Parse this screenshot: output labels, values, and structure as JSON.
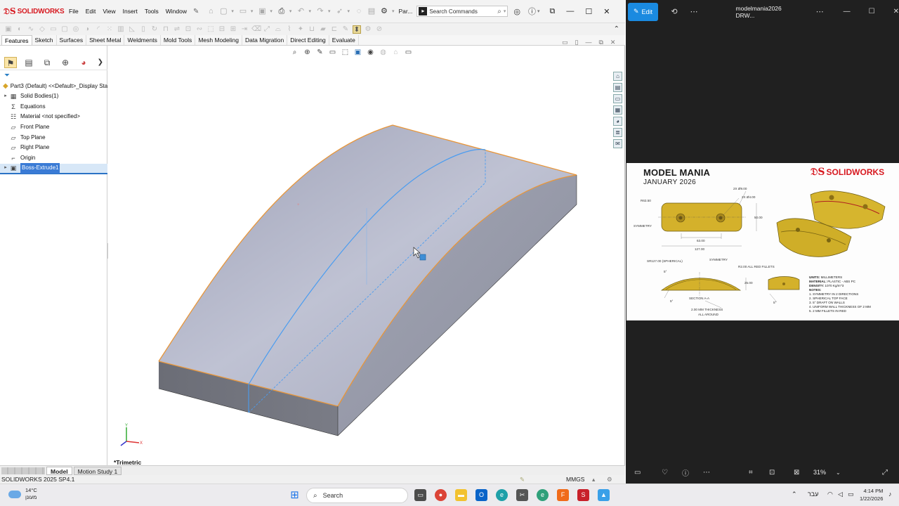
{
  "solidworks": {
    "brand": "SOLIDWORKS",
    "menus": [
      "File",
      "Edit",
      "View",
      "Insert",
      "Tools",
      "Window"
    ],
    "doc_label": "Par...",
    "search_placeholder": "Search Commands",
    "command_tabs": [
      "Features",
      "Sketch",
      "Surfaces",
      "Sheet Metal",
      "Weldments",
      "Mold Tools",
      "Mesh Modeling",
      "Data Migration",
      "Direct Editing",
      "Evaluate"
    ],
    "active_tab": "Features",
    "tree": {
      "root": "Part3 (Default) <<Default>_Display Sta",
      "items": [
        {
          "label": "Solid Bodies(1)",
          "icon": "folder-icon",
          "expandable": true
        },
        {
          "label": "Equations",
          "icon": "equations-icon",
          "expandable": false
        },
        {
          "label": "Material <not specified>",
          "icon": "material-icon",
          "expandable": false
        },
        {
          "label": "Front Plane",
          "icon": "plane-icon",
          "expandable": false
        },
        {
          "label": "Top Plane",
          "icon": "plane-icon",
          "expandable": false
        },
        {
          "label": "Right Plane",
          "icon": "plane-icon",
          "expandable": false
        },
        {
          "label": "Origin",
          "icon": "origin-icon",
          "expandable": false
        },
        {
          "label": "Boss-Extrude1",
          "icon": "extrude-icon",
          "expandable": true,
          "selected": true
        }
      ]
    },
    "view_orientation": "*Trimetric",
    "bottom_tabs": [
      "Model",
      "Motion Study 1"
    ],
    "active_bottom_tab": "Model",
    "status_text": "SOLIDWORKS 2025 SP4.1",
    "units": "MMGS",
    "colors": {
      "edge": "#e8963a",
      "sketch": "#4a9cf0",
      "body_top": "#b4b7c9",
      "body_side": "#6e7079"
    }
  },
  "photos": {
    "edit_label": "Edit",
    "title": "modelmania2026 DRW...",
    "zoom": "31%",
    "drawing": {
      "title": "MODEL MANIA",
      "subtitle": "JANUARY 2026",
      "brand": "SOLIDWORKS",
      "dims": {
        "r63": "R63.50",
        "hole9": "2X Ø9.00",
        "hole4": "2X Ø4.00",
        "sym1": "SYMMETRY",
        "w63": "63.00",
        "w127": "127.00",
        "h50": "50.00",
        "sr127": "SR127.00 (SPHERICAL)",
        "sym2": "SYMMETRY",
        "fillets": "R2.00 ALL RED FILLETS",
        "draft": "5°",
        "draft2": "5°",
        "h25": "25.00",
        "section": "SECTION A-A",
        "thick1": "2.00 MM THICKNESS",
        "thick2": "ALL AROUND",
        "draft3": "5°"
      },
      "notes": {
        "units_k": "UNITS:",
        "units_v": "MILLIMETERS",
        "material_k": "MATERIAL:",
        "material_v": "PLASTIC - ABS PC",
        "density_k": "DENSITY:",
        "density_v": "1070 Kg/m^3",
        "notes_k": "NOTES:",
        "n1": "1.  SYMMETRY IN 2 DIRECTIONS",
        "n2": "2.  SPHERICAL TOP FACE",
        "n3": "3.  5° DRAFT ON WALLS",
        "n4": "4.  UNIFORM WALL THICKNESS OF 2 MM",
        "n5": "5.  2 MM FILLETS IN RED"
      }
    }
  },
  "taskbar": {
    "temp": "14°C",
    "weather_desc": "מעונן",
    "search_label": "Search",
    "lang": "עבר",
    "time": "4:14 PM",
    "date": "1/22/2026"
  }
}
